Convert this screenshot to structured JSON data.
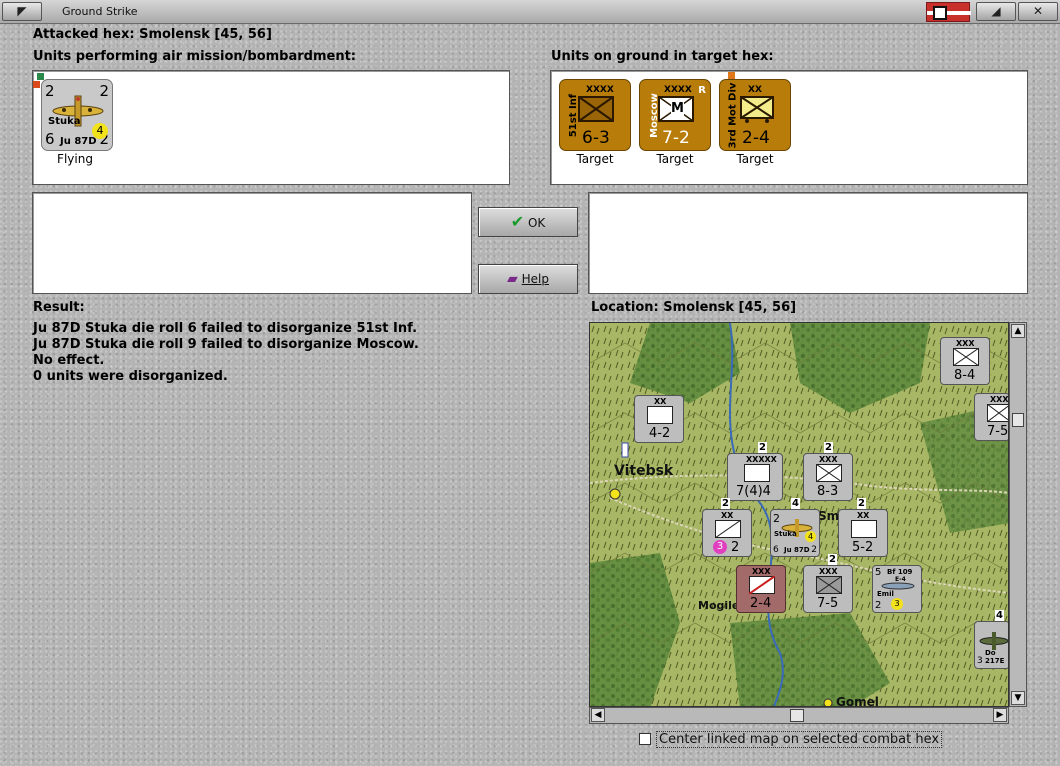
{
  "window": {
    "title": "Ground Strike"
  },
  "attacked_hex": "Attacked hex: Smolensk  [45, 56]",
  "air_units_label": "Units performing air mission/bombardment:",
  "ground_units_label": "Units on ground in target hex:",
  "air_units": [
    {
      "attack": "2",
      "range": "2",
      "defense": "6",
      "move": "2",
      "name": "Stuka",
      "model": "Ju 87D",
      "badge": "4",
      "status": "Flying"
    }
  ],
  "ground_units": [
    {
      "size": "XXXX",
      "name": "51st Inf",
      "strength": "6-3",
      "status": "Target"
    },
    {
      "size": "XXXX",
      "name": "Moscow",
      "flag": "R",
      "symbol": "M",
      "strength": "7-2",
      "status": "Target"
    },
    {
      "size": "XX",
      "name": "3rd Mot Div",
      "strength": "2-4",
      "status": "Target"
    }
  ],
  "buttons": {
    "ok": "OK",
    "help": "Help"
  },
  "result_label": "Result:",
  "result_lines": [
    "Ju 87D Stuka die roll 6 failed to disorganize 51st Inf.",
    "Ju 87D Stuka die roll 9 failed to disorganize Moscow.",
    "No effect.",
    "0 units were disorganized."
  ],
  "location_label": "Location:  Smolensk  [45, 56]",
  "map": {
    "cities": [
      "Vitebsk",
      "Mogile",
      "Gomel",
      "Smo"
    ],
    "counters": [
      {
        "size": "XX",
        "strength": "4-2"
      },
      {
        "size": "XXXXX",
        "strength": "7(4)4",
        "stack": "2"
      },
      {
        "size": "XXX",
        "strength": "8-3",
        "stack": "2"
      },
      {
        "size": "XX",
        "strength": "2",
        "badge": "3",
        "stack": "2"
      },
      {
        "size": "XX",
        "strength": "5-2",
        "stack": "2"
      },
      {
        "size": "XXX",
        "strength": "2-4"
      },
      {
        "size": "XXX",
        "strength": "7-5",
        "stack": "2"
      },
      {
        "size": "XXX",
        "strength": "8-4"
      },
      {
        "size": "XXX",
        "strength": "7-5"
      }
    ],
    "air_counters": [
      {
        "top": "2",
        "name": "Stuka",
        "defense": "6",
        "model": "Ju 87D",
        "move": "2",
        "badge": "4",
        "stack": "4"
      },
      {
        "top": "5",
        "model": "Bf 109",
        "sub": "E-4",
        "name": "Emil",
        "defense": "2",
        "badge": "3"
      },
      {
        "top": "3",
        "model": "Do 217E",
        "stack": "4"
      }
    ]
  },
  "center_checkbox_label": "Center linked map on selected combat hex"
}
